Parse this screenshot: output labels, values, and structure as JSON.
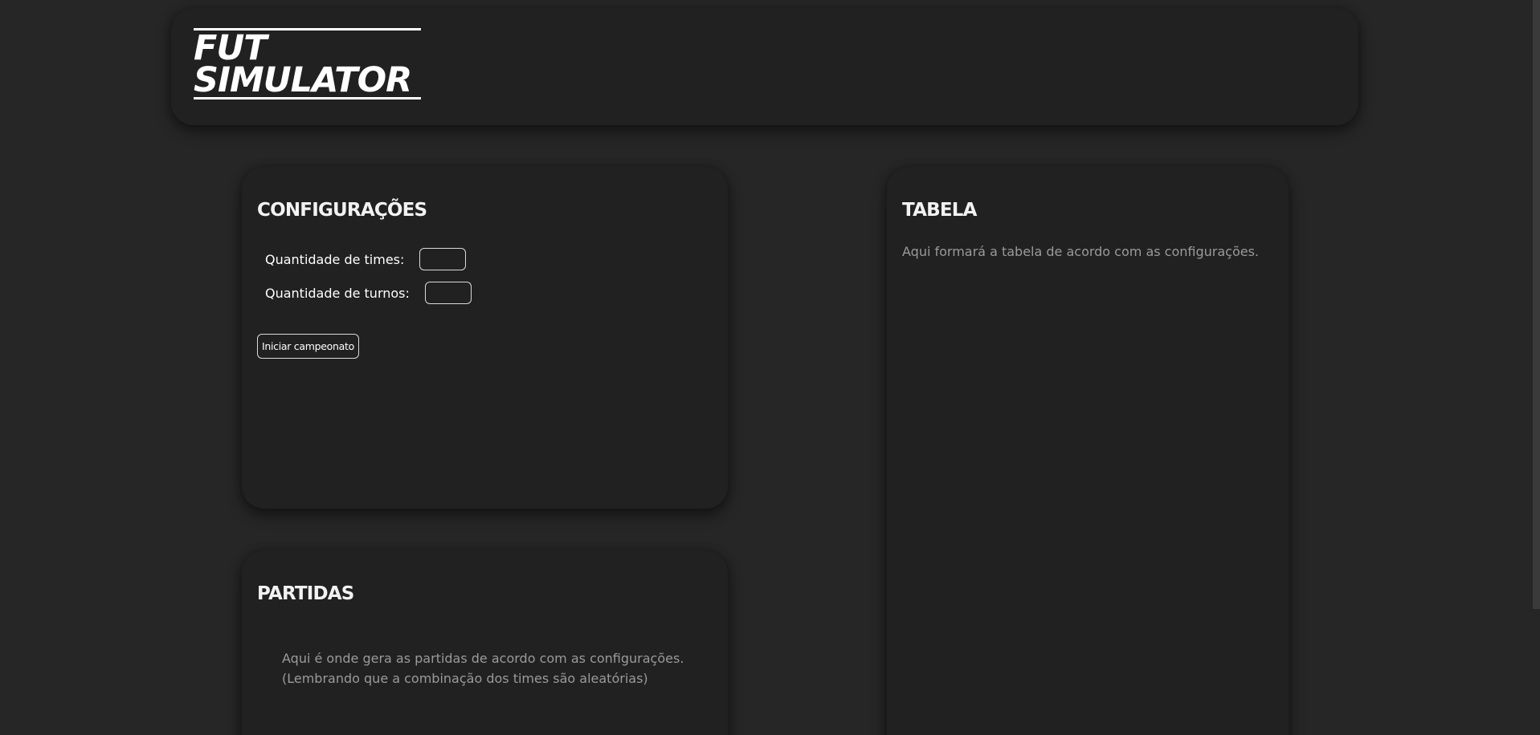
{
  "header": {
    "logo_line1": "FUT",
    "logo_line2": "SIMULATOR"
  },
  "config": {
    "title": "CONFIGURAÇÕES",
    "teams_label": "Quantidade de times:",
    "teams_value": "",
    "rounds_label": "Quantidade de turnos:",
    "rounds_value": "",
    "start_button": "Iniciar campeonato"
  },
  "partidas": {
    "title": "PARTIDAS",
    "line1": "Aqui é onde gera as partidas de acordo com as configurações.",
    "line2": "(Lembrando que a combinação dos times são aleatórias)"
  },
  "tabela": {
    "title": "TABELA",
    "description": "Aqui formará a tabela de acordo com as configurações."
  },
  "colors": {
    "background": "#262626",
    "card": "#212121",
    "text": "#ffffff",
    "muted": "#9a9a9a"
  }
}
